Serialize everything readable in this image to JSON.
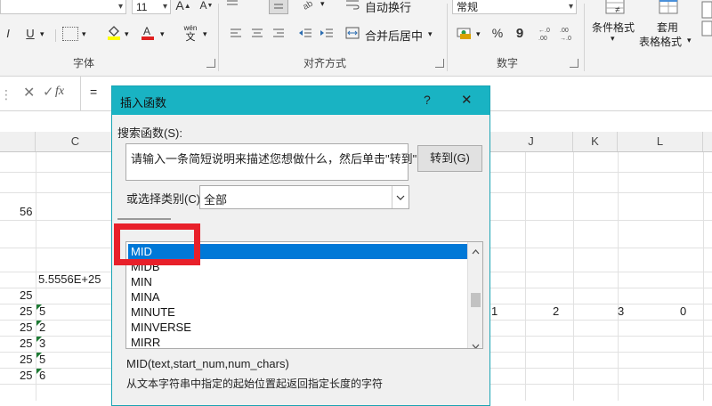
{
  "ribbon": {
    "font_size": "11",
    "font_group_label": "字体",
    "align_group_label": "对齐方式",
    "wrap_text_label": "自动换行",
    "merge_center_label": "合并后居中",
    "number_format": "常规",
    "number_group_label": "数字",
    "conditional_format_label": "条件格式",
    "table_format_label1": "套用",
    "table_format_label2": "表格格式",
    "italic": "I",
    "underline": "U",
    "wen": "wén",
    "wen_char": "文",
    "percent": "%",
    "comma": "9"
  },
  "formula_bar": {
    "fx": "fx",
    "equals": "="
  },
  "columns": [
    "C",
    "J",
    "K",
    "L"
  ],
  "cells": {
    "b_56": "56",
    "c_sci": "5.5556E+25",
    "b_25": [
      "25",
      "25",
      "25",
      "25",
      "25",
      "25"
    ],
    "c_vals": [
      "5",
      "2",
      "3",
      "5",
      "6"
    ],
    "row_vals": [
      "1",
      "2",
      "3",
      "0"
    ]
  },
  "dialog": {
    "title": "插入函数",
    "help": "?",
    "close": "✕",
    "search_label": "搜索函数(S):",
    "search_placeholder": "请输入一条简短说明来描述您想做什么，然后单击\"转到\"",
    "go_button": "转到(G)",
    "category_label": "或选择类别(C):",
    "category_value": "全部",
    "functions": [
      "MID",
      "MIDB",
      "MIN",
      "MINA",
      "MINUTE",
      "MINVERSE",
      "MIRR"
    ],
    "selected_function": "MID",
    "signature": "MID(text,start_num,num_chars)",
    "description": "从文本字符串中指定的起始位置起返回指定长度的字符",
    "highlight_color": "#e8202a",
    "title_color": "#19b3c3",
    "select_color": "#0078d7"
  }
}
